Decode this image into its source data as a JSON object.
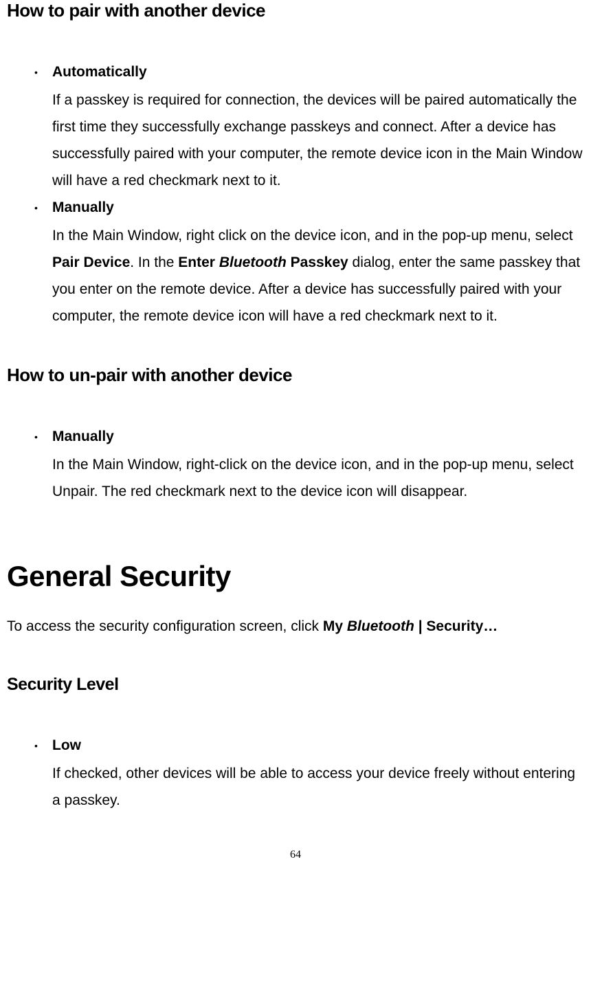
{
  "sections": {
    "pair": {
      "heading": "How to pair with another device",
      "items": [
        {
          "title": "Automatically",
          "body_plain": "If a passkey is required for connection, the devices will be paired automatically the first time they successfully exchange passkeys and connect. After a device has successfully paired with your computer, the remote device icon in the Main Window will have a red checkmark next to it."
        },
        {
          "title": "Manually",
          "body_parts": {
            "p1": "In the Main Window, right click on the device icon, and in the pop-up menu, select ",
            "b1": "Pair Device",
            "p2": ". In the ",
            "b2": "Enter ",
            "bi": "Bluetooth",
            "b3": " Passkey",
            "p3": " dialog, enter the same passkey that you enter on the remote device. After a device has successfully paired with your computer, the remote device icon will have a red checkmark next to it."
          }
        }
      ]
    },
    "unpair": {
      "heading": "How to un-pair with another device",
      "items": [
        {
          "title": "Manually",
          "body_plain": "In the Main Window, right-click on the device icon, and in the pop-up menu, select Unpair. The red checkmark next to the device icon will disappear."
        }
      ]
    },
    "general": {
      "heading": "General Security",
      "intro_parts": {
        "p1": "To access the security configuration screen, click ",
        "b1": "My ",
        "bi": "Bluetooth",
        "b2": " | Security…"
      }
    },
    "seclevel": {
      "heading": "Security Level",
      "items": [
        {
          "title": "Low",
          "body_plain": "If checked, other devices will be able to access your device freely without entering a passkey."
        }
      ]
    }
  },
  "page_number": "64"
}
